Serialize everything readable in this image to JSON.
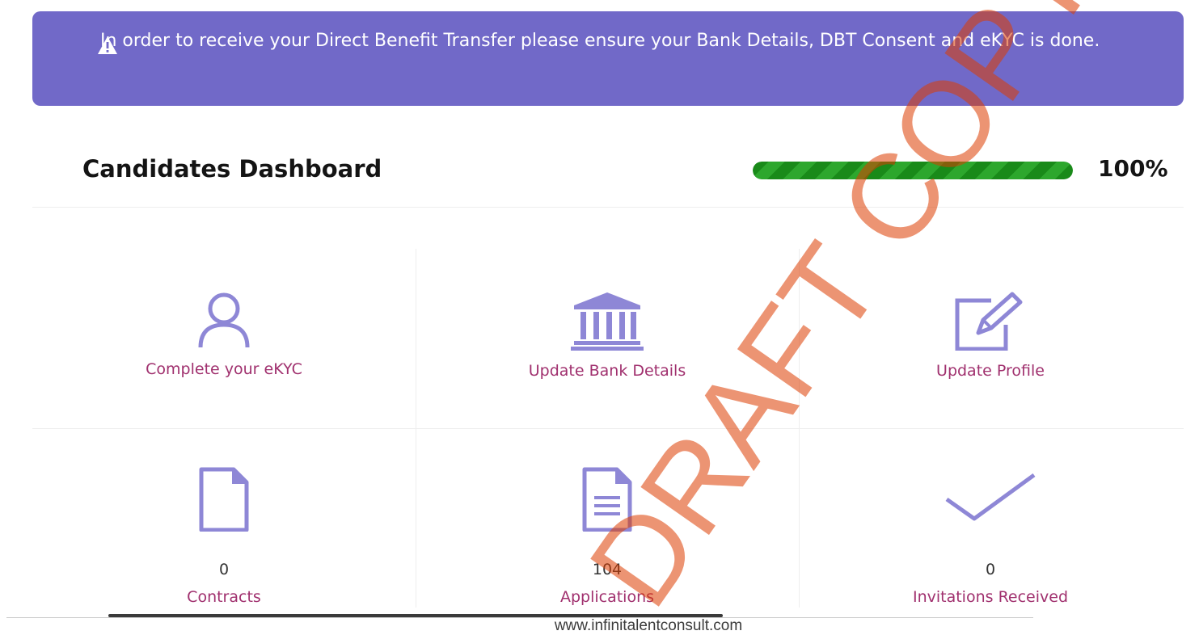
{
  "alert": {
    "icon": "warning-triangle-icon",
    "text": "In order to receive your Direct Benefit Transfer please ensure your Bank Details, DBT Consent and eKYC is done."
  },
  "dashboard": {
    "title": "Candidates Dashboard",
    "progress_fraction": 1.0,
    "progress_text": "100%"
  },
  "tiles": [
    {
      "icon": "user-icon",
      "label": "Complete your eKYC"
    },
    {
      "icon": "bank-icon",
      "label": "Update Bank Details"
    },
    {
      "icon": "edit-icon",
      "label": "Update Profile"
    }
  ],
  "stats": [
    {
      "icon": "file-icon",
      "count": "0",
      "label": "Contracts"
    },
    {
      "icon": "document-icon",
      "count": "104",
      "label": "Applications"
    },
    {
      "icon": "check-icon",
      "count": "0",
      "label": "Invitations Received"
    }
  ],
  "footer": {
    "url": "www.infinitalentconsult.com"
  },
  "watermark": "DRAFT COPY",
  "colors": {
    "alert_bg": "#7169c8",
    "icon_color": "#8e87d6",
    "link_color": "#a0306e",
    "progress_color": "#198a19"
  }
}
